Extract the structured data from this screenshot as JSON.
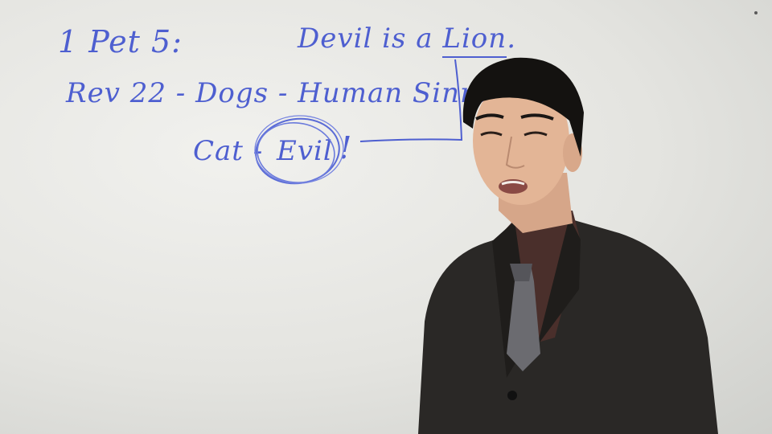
{
  "whiteboard": {
    "line1_left": "1 Pet 5:",
    "line1_right_prefix": "Devil is a",
    "line1_right_word": "Lion",
    "line1_right_suffix": ".",
    "line2": "Rev 22 - Dogs - Human Sinners",
    "line3_left": "Cat -",
    "line3_circled": "Evil",
    "line3_mark": "!",
    "ink_color": "#4e5fd0"
  },
  "presenter": {
    "suit_color": "#2a2826",
    "shirt_color": "#4a2f2b",
    "skin_color": "#e3b596",
    "hair_color": "#141210"
  }
}
